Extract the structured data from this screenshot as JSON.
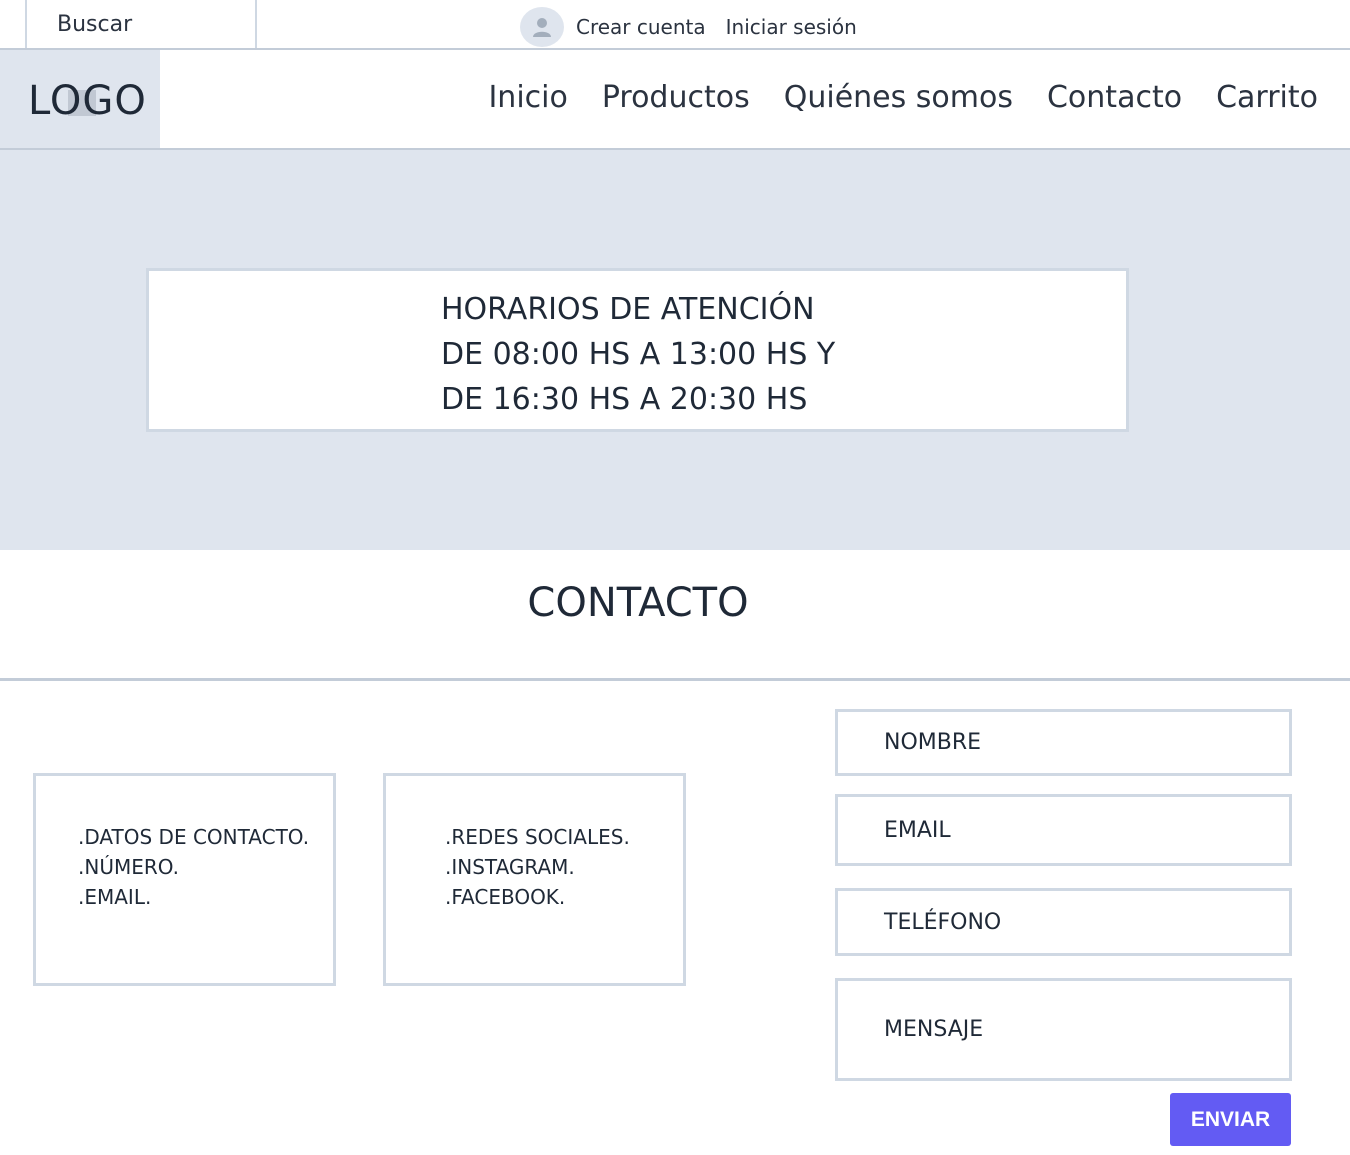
{
  "topbar": {
    "search_label": "Buscar",
    "create_account": "Crear cuenta",
    "login": "Iniciar sesión"
  },
  "header": {
    "logo_text": "LOGO",
    "nav": [
      "Inicio",
      "Productos",
      "Quiénes somos",
      "Contacto",
      "Carrito"
    ]
  },
  "hours": {
    "line1": "HORARIOS DE ATENCIÓN",
    "line2": "DE 08:00 HS A 13:00 HS Y",
    "line3": "DE 16:30 HS A 20:30 HS"
  },
  "contact": {
    "title": "CONTACTO",
    "info_box_1": [
      ".DATOS DE CONTACTO.",
      ".NÚMERO.",
      ".EMAIL."
    ],
    "info_box_2": [
      ".REDES SOCIALES.",
      ".INSTAGRAM.",
      ".FACEBOOK."
    ]
  },
  "form": {
    "nombre": "NOMBRE",
    "email": "EMAIL",
    "telefono": "TELÉFONO",
    "mensaje": "MENSAJE",
    "submit": "ENVIAR"
  },
  "colors": {
    "accent": "#635bf3",
    "band": "#dfe5ee",
    "border": "#cfd8e3"
  },
  "icons": {
    "avatar": "user-avatar-icon"
  }
}
